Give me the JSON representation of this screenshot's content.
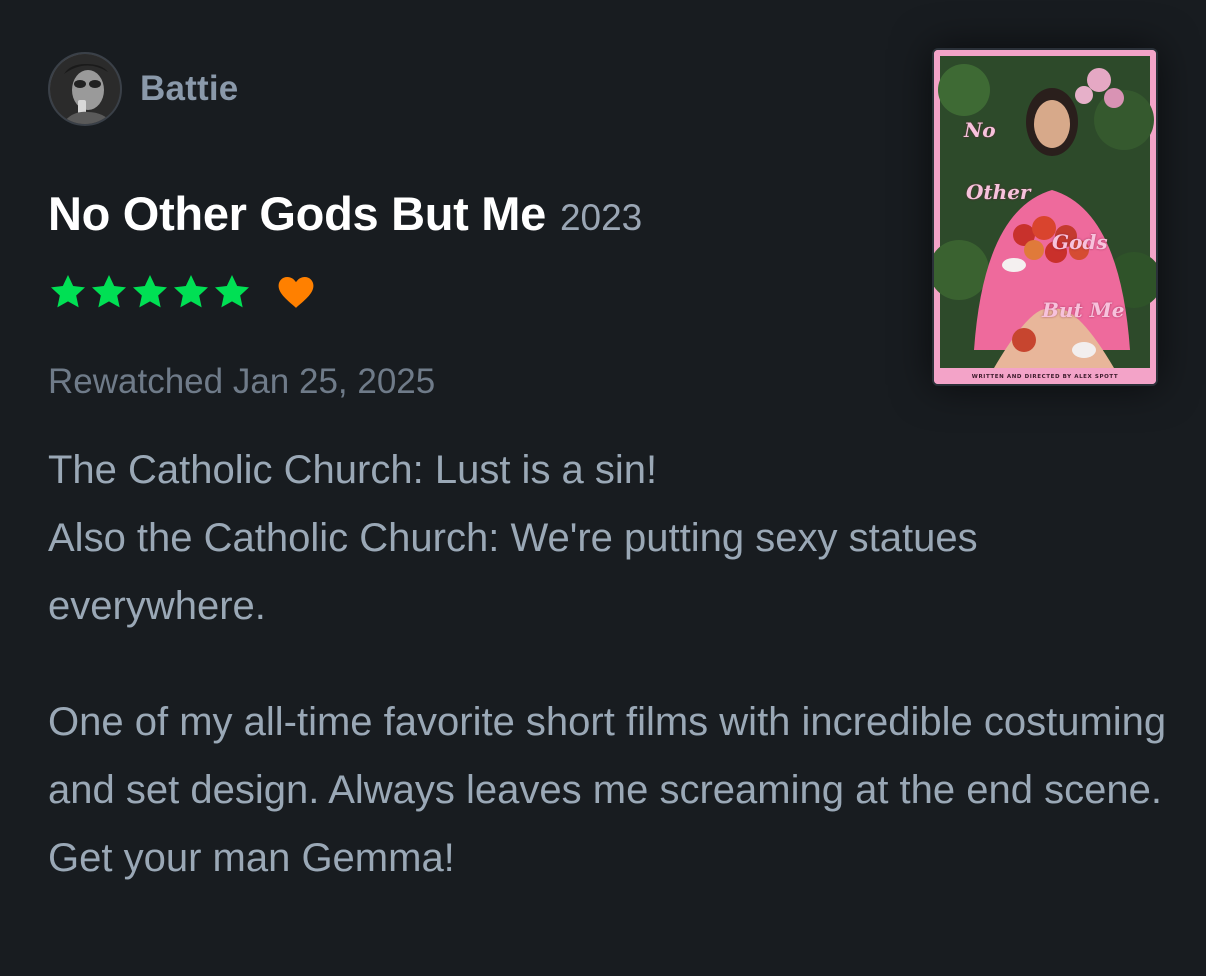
{
  "author": {
    "name": "Battie"
  },
  "film": {
    "title": "No Other Gods But Me",
    "year": "2023"
  },
  "rating": {
    "stars": 5,
    "max_stars": 5,
    "liked": true,
    "star_color": "#00e054",
    "heart_color": "#ff8000"
  },
  "watched_label": "Rewatched Jan 25, 2025",
  "review": {
    "paragraphs": [
      "The Catholic Church: Lust is a sin!\nAlso the Catholic Church: We're putting sexy statues everywhere.",
      "One of my all-time favorite short films with incredible costuming and set design. Always leaves me screaming at the end scene. Get your man Gemma!"
    ]
  },
  "poster": {
    "words": [
      "No",
      "Other",
      "Gods",
      "But Me"
    ],
    "credit": "WRITTEN AND DIRECTED BY ALEX SPOTT"
  },
  "colors": {
    "background": "#181c20",
    "author_text": "#8a99aa",
    "title_text": "#ffffff",
    "year_text": "#9aa6b4",
    "meta_text": "#6f7b89",
    "body_text": "#9aa8b6",
    "poster_pink": "#f3a3c8"
  }
}
